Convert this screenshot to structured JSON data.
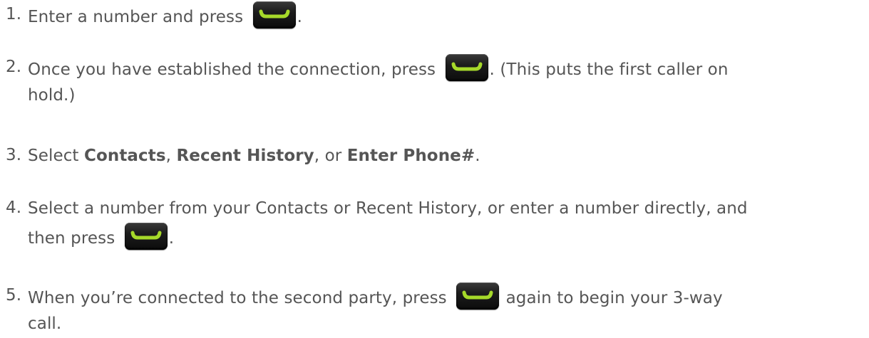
{
  "steps": [
    {
      "num": "1.",
      "lines": [
        [
          {
            "t": "text",
            "v": "Enter a number and press "
          },
          {
            "t": "key",
            "icon": "talk-key-icon"
          },
          {
            "t": "text",
            "v": "."
          }
        ]
      ]
    },
    {
      "num": "2.",
      "lines": [
        [
          {
            "t": "text",
            "v": "Once you have established the connection, press "
          },
          {
            "t": "key",
            "icon": "talk-key-icon"
          },
          {
            "t": "text",
            "v": ". (This puts the first caller on"
          }
        ],
        [
          {
            "t": "text",
            "v": "hold.)"
          }
        ]
      ]
    },
    {
      "num": "3.",
      "lines": [
        [
          {
            "t": "text",
            "v": "Select "
          },
          {
            "t": "bold",
            "v": "Contacts"
          },
          {
            "t": "text",
            "v": ", "
          },
          {
            "t": "bold",
            "v": "Recent History"
          },
          {
            "t": "text",
            "v": ", or "
          },
          {
            "t": "bold",
            "v": "Enter Phone#"
          },
          {
            "t": "text",
            "v": "."
          }
        ]
      ]
    },
    {
      "num": "4.",
      "lines": [
        [
          {
            "t": "text",
            "v": "Select a number from your Contacts or Recent History, or enter a number directly, and"
          }
        ],
        [
          {
            "t": "text",
            "v": "then press "
          },
          {
            "t": "key",
            "icon": "talk-key-icon"
          },
          {
            "t": "text",
            "v": "."
          }
        ]
      ]
    },
    {
      "num": "5.",
      "lines": [
        [
          {
            "t": "text",
            "v": "When you’re connected to the second party, press "
          },
          {
            "t": "key",
            "icon": "talk-key-icon"
          },
          {
            "t": "text",
            "v": " again to begin your 3-way"
          }
        ],
        [
          {
            "t": "text",
            "v": "call."
          }
        ]
      ]
    }
  ],
  "colors": {
    "text": "#555555",
    "key_body": "#1c1c1c",
    "key_bar": "#a6d92a"
  }
}
